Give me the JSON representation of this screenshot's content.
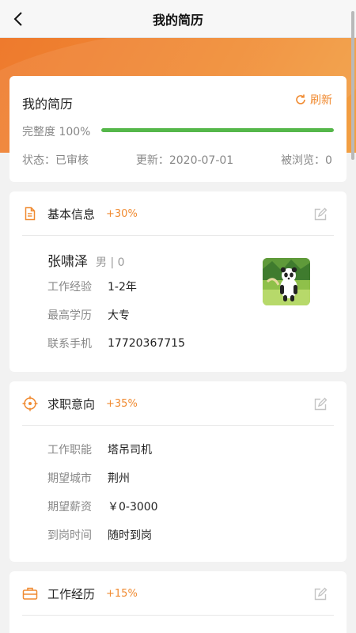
{
  "nav": {
    "title": "我的简历"
  },
  "summary": {
    "title": "我的简历",
    "refresh_label": "刷新",
    "completeness_label": "完整度 100%",
    "completeness_value": 1.0,
    "status": "状态：已审核",
    "updated": "更新：2020-07-01",
    "views": "被浏览：0"
  },
  "basic": {
    "title": "基本信息",
    "percent": "+30%",
    "name": "张啸泽",
    "meta": "男 | 0",
    "fields": [
      {
        "key": "工作经验",
        "value": "1-2年"
      },
      {
        "key": "最高学历",
        "value": "大专"
      },
      {
        "key": "联系手机",
        "value": "17720367715"
      }
    ]
  },
  "intent": {
    "title": "求职意向",
    "percent": "+35%",
    "fields": [
      {
        "key": "工作职能",
        "value": "塔吊司机"
      },
      {
        "key": "期望城市",
        "value": "荆州"
      },
      {
        "key": "期望薪资",
        "value": "￥0-3000"
      },
      {
        "key": "到岗时间",
        "value": "随时到岗"
      }
    ]
  },
  "work": {
    "title": "工作经历",
    "percent": "+15%"
  },
  "colors": {
    "accent": "#f08a30",
    "progress": "#55b74a",
    "banner": "#ee7a2d"
  },
  "icons": {
    "back": "chevron-left-icon",
    "refresh": "refresh-icon",
    "basic": "document-icon",
    "intent": "target-icon",
    "work": "briefcase-icon",
    "edit": "edit-icon"
  }
}
